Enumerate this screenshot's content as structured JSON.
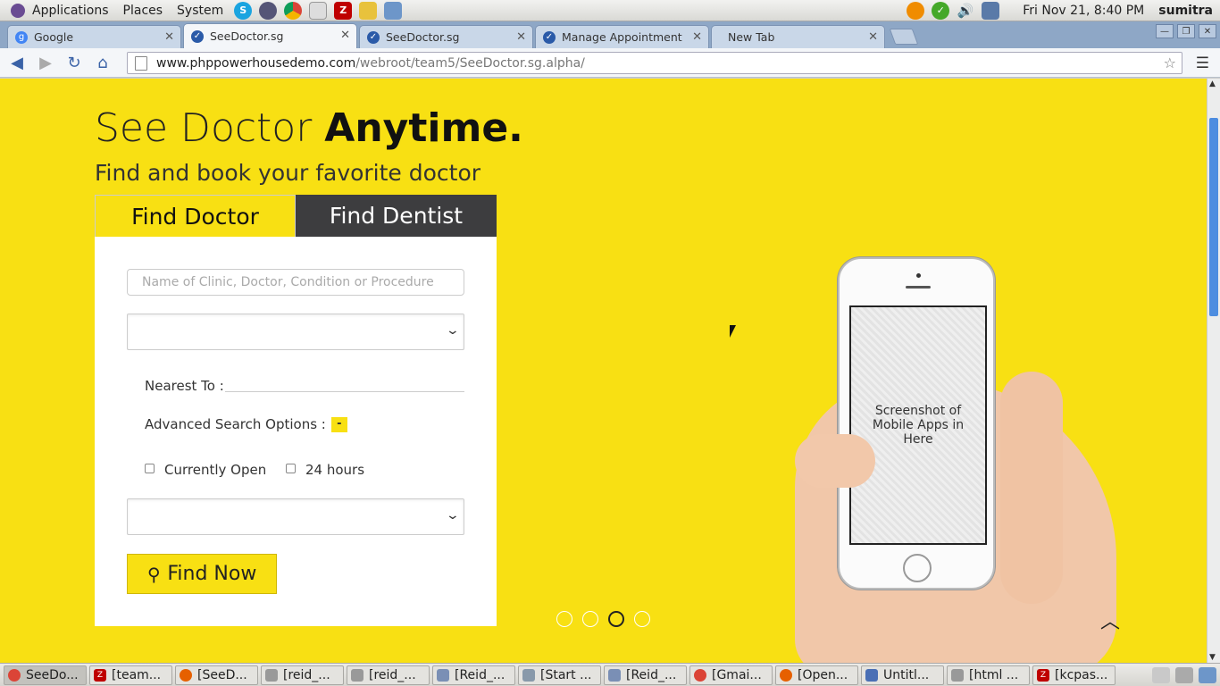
{
  "panel": {
    "menus": [
      "Applications",
      "Places",
      "System"
    ],
    "clock": "Fri Nov 21,  8:40 PM",
    "user": "sumitra"
  },
  "browser": {
    "tabs": [
      {
        "title": "Google",
        "active": false
      },
      {
        "title": "SeeDoctor.sg",
        "active": true
      },
      {
        "title": "SeeDoctor.sg",
        "active": false
      },
      {
        "title": "Manage Appointment",
        "active": false
      },
      {
        "title": "New Tab",
        "active": false
      }
    ],
    "url_host": "www.phppowerhousedemo.com",
    "url_path": "/webroot/team5/SeeDoctor.sg.alpha/"
  },
  "page": {
    "hero_title_light": "See Doctor ",
    "hero_title_bold": "Anytime.",
    "hero_subtitle": "Find and book your favorite doctor",
    "tab_find_doctor": "Find Doctor",
    "tab_find_dentist": "Find Dentist",
    "search_placeholder": "Name of Clinic, Doctor, Condition or Procedure",
    "nearest_label": "Nearest To :",
    "advanced_label": "Advanced Search Options :",
    "advanced_toggle": "-",
    "currently_open_label": "Currently Open",
    "hours_label": "24 hours",
    "find_now_label": "Find Now",
    "phone_screen_text": "Screenshot of Mobile Apps in Here",
    "carousel_active_index": 2
  },
  "taskbar": {
    "items": [
      "SeeDo...",
      "[team...",
      "[SeeD...",
      "[reid_...",
      "[reid_...",
      "[Reid_...",
      "[Start ...",
      "[Reid_...",
      "[Gmai...",
      "[Open...",
      "Untitl...",
      "[html ...",
      "[kcpas..."
    ]
  },
  "colors": {
    "brand_yellow": "#f8e013",
    "dark_tab": "#3d3d3f",
    "scroll_thumb": "#4d8de0"
  }
}
